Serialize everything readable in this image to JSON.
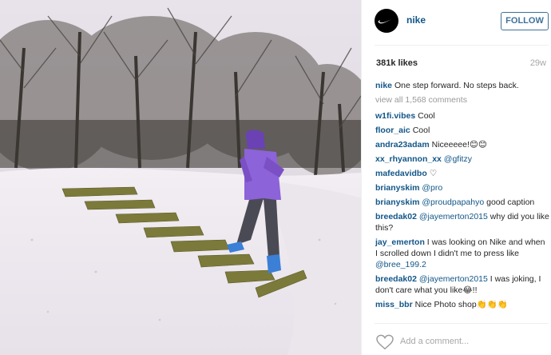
{
  "post": {
    "username": "nike",
    "follow_label": "FOLLOW",
    "likes": "381k likes",
    "age": "29w",
    "caption_user": "nike",
    "caption_text": "One step forward. No steps back.",
    "view_all": "view all 1,568 comments",
    "add_comment_placeholder": "Add a comment..."
  },
  "comments": [
    {
      "user": "w1fi.vibes",
      "text": "Cool"
    },
    {
      "user": "floor_aic",
      "text": "Cool"
    },
    {
      "user": "andra23adam",
      "text": "Niceeeee!😊😊"
    },
    {
      "user": "xx_rhyannon_xx",
      "mention": "@gfitzy",
      "text": ""
    },
    {
      "user": "mafedavidbo",
      "text": "♡"
    },
    {
      "user": "brianyskim",
      "mention": "@pro",
      "text": ""
    },
    {
      "user": "brianyskim",
      "mention": "@proudpapahyo",
      "text": "good caption"
    },
    {
      "user": "breedak02",
      "mention": "@jayemerton2015",
      "text": "why did you like this?"
    },
    {
      "user": "jay_emerton",
      "text": "I was looking on Nike and when I scrolled down I didn't me to press like",
      "mention_after": "@bree_199.2"
    },
    {
      "user": "breedak02",
      "mention": "@jayemerton2015",
      "text": "I was joking, I don't care what you like😂!!"
    },
    {
      "user": "miss_bbr",
      "text": "Nice Photo shop👏👏👏"
    }
  ],
  "icons": {
    "avatar_logo": "nike-swoosh-icon",
    "like": "heart-icon"
  }
}
